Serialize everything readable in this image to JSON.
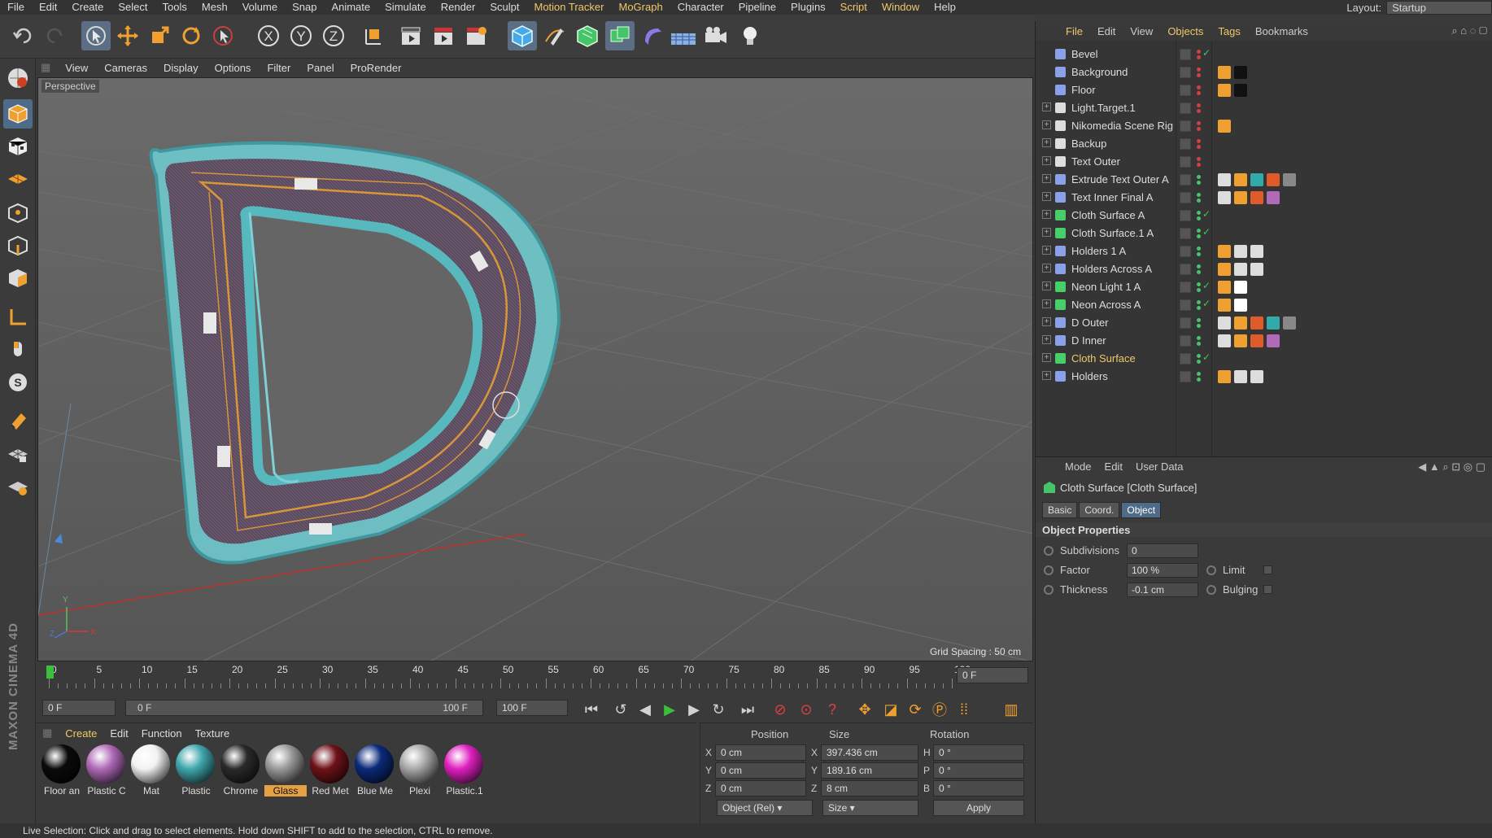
{
  "menu": [
    "File",
    "Edit",
    "Create",
    "Select",
    "Tools",
    "Mesh",
    "Volume",
    "Snap",
    "Animate",
    "Simulate",
    "Render",
    "Sculpt",
    "Motion Tracker",
    "MoGraph",
    "Character",
    "Pipeline",
    "Plugins",
    "Script",
    "Window",
    "Help"
  ],
  "layout": {
    "label": "Layout:",
    "value": "Startup"
  },
  "viewport": {
    "menu": [
      "View",
      "Cameras",
      "Display",
      "Options",
      "Filter",
      "Panel",
      "ProRender"
    ],
    "camera_label": "Perspective",
    "grid_spacing": "Grid Spacing : 50 cm"
  },
  "timeline": {
    "ticks": [
      "0",
      "5",
      "10",
      "15",
      "20",
      "25",
      "30",
      "35",
      "40",
      "45",
      "50",
      "55",
      "60",
      "65",
      "70",
      "75",
      "80",
      "85",
      "90",
      "95",
      "100"
    ],
    "current_frame": "0 F",
    "start": "0 F",
    "range_start": "0 F",
    "range_end": "100 F",
    "end": "100 F"
  },
  "materials": {
    "menu": [
      "Create",
      "Edit",
      "Function",
      "Texture"
    ],
    "items": [
      {
        "name": "Floor an",
        "color": "#0a0a0a"
      },
      {
        "name": "Plastic C",
        "color": "#b06ab8"
      },
      {
        "name": "Mat",
        "color": "#f2f2f2"
      },
      {
        "name": "Plastic",
        "color": "#3fa7ad"
      },
      {
        "name": "Chrome",
        "color": "#2a2a2a"
      },
      {
        "name": "Glass",
        "color": "#9a9a9a"
      },
      {
        "name": "Red Met",
        "color": "#6e1218"
      },
      {
        "name": "Blue Me",
        "color": "#0a2a7a"
      },
      {
        "name": "Plexi",
        "color": "#a8a8a8"
      },
      {
        "name": "Plastic.1",
        "color": "#e020c0"
      }
    ],
    "selected": "Glass"
  },
  "coords": {
    "headers": [
      "Position",
      "Size",
      "Rotation"
    ],
    "rows": [
      {
        "axis": "X",
        "pos": "0 cm",
        "size_axis": "X",
        "size": "397.436 cm",
        "rot_axis": "H",
        "rot": "0 °"
      },
      {
        "axis": "Y",
        "pos": "0 cm",
        "size_axis": "Y",
        "size": "189.16 cm",
        "rot_axis": "P",
        "rot": "0 °"
      },
      {
        "axis": "Z",
        "pos": "0 cm",
        "size_axis": "Z",
        "size": "8 cm",
        "rot_axis": "B",
        "rot": "0 °"
      }
    ],
    "mode": "Object (Rel)",
    "size_mode": "Size",
    "apply": "Apply"
  },
  "objects": {
    "tabs": [
      "File",
      "Edit",
      "View",
      "Objects",
      "Tags",
      "Bookmarks"
    ],
    "items": [
      {
        "name": "Bevel",
        "icon": "bevel-icon",
        "color": "#8aa0e8"
      },
      {
        "name": "Background",
        "icon": "background-icon",
        "color": "#8aa0e8"
      },
      {
        "name": "Floor",
        "icon": "floor-icon",
        "color": "#8aa0e8"
      },
      {
        "name": "Light.Target.1",
        "icon": "null-icon",
        "color": "#dddddd"
      },
      {
        "name": "Nikomedia Scene Rig",
        "icon": "null-icon",
        "color": "#dddddd"
      },
      {
        "name": "Backup",
        "icon": "null-icon",
        "color": "#dddddd"
      },
      {
        "name": "Text Outer",
        "icon": "null-icon",
        "color": "#dddddd"
      },
      {
        "name": "Extrude Text Outer A",
        "icon": "extrude-icon",
        "color": "#8aa0e8"
      },
      {
        "name": "Text Inner Final A",
        "icon": "extrude-icon",
        "color": "#8aa0e8"
      },
      {
        "name": "Cloth Surface A",
        "icon": "cloth-icon",
        "color": "#46d06a"
      },
      {
        "name": "Cloth Surface.1 A",
        "icon": "cloth-icon",
        "color": "#46d06a"
      },
      {
        "name": "Holders 1 A",
        "icon": "extrude-icon",
        "color": "#8aa0e8"
      },
      {
        "name": "Holders Across A",
        "icon": "extrude-icon",
        "color": "#8aa0e8"
      },
      {
        "name": "Neon Light 1 A",
        "icon": "sweep-icon",
        "color": "#46d06a"
      },
      {
        "name": "Neon Across A",
        "icon": "sweep-icon",
        "color": "#46d06a"
      },
      {
        "name": "D Outer",
        "icon": "extrude-icon",
        "color": "#8aa0e8"
      },
      {
        "name": "D Inner",
        "icon": "extrude-icon",
        "color": "#8aa0e8"
      },
      {
        "name": "Cloth Surface",
        "icon": "cloth-icon",
        "color": "#46d06a"
      },
      {
        "name": "Holders",
        "icon": "extrude-icon",
        "color": "#8aa0e8"
      }
    ],
    "selected": "Cloth Surface"
  },
  "attributes": {
    "menu": [
      "Mode",
      "Edit",
      "User Data"
    ],
    "title": "Cloth Surface [Cloth Surface]",
    "tabs": [
      "Basic",
      "Coord.",
      "Object"
    ],
    "active_tab": "Object",
    "section": "Object Properties",
    "props": [
      {
        "label": "Subdivisions",
        "value": "0"
      },
      {
        "label": "Factor",
        "value": "100 %"
      },
      {
        "label": "Thickness",
        "value": "-0.1 cm"
      }
    ],
    "checks": [
      {
        "label": "Limit"
      },
      {
        "label": "Bulging"
      }
    ]
  },
  "status": "Live Selection: Click and drag to select elements. Hold down SHIFT to add to the selection, CTRL to remove.",
  "brand": "MAXON CINEMA 4D"
}
